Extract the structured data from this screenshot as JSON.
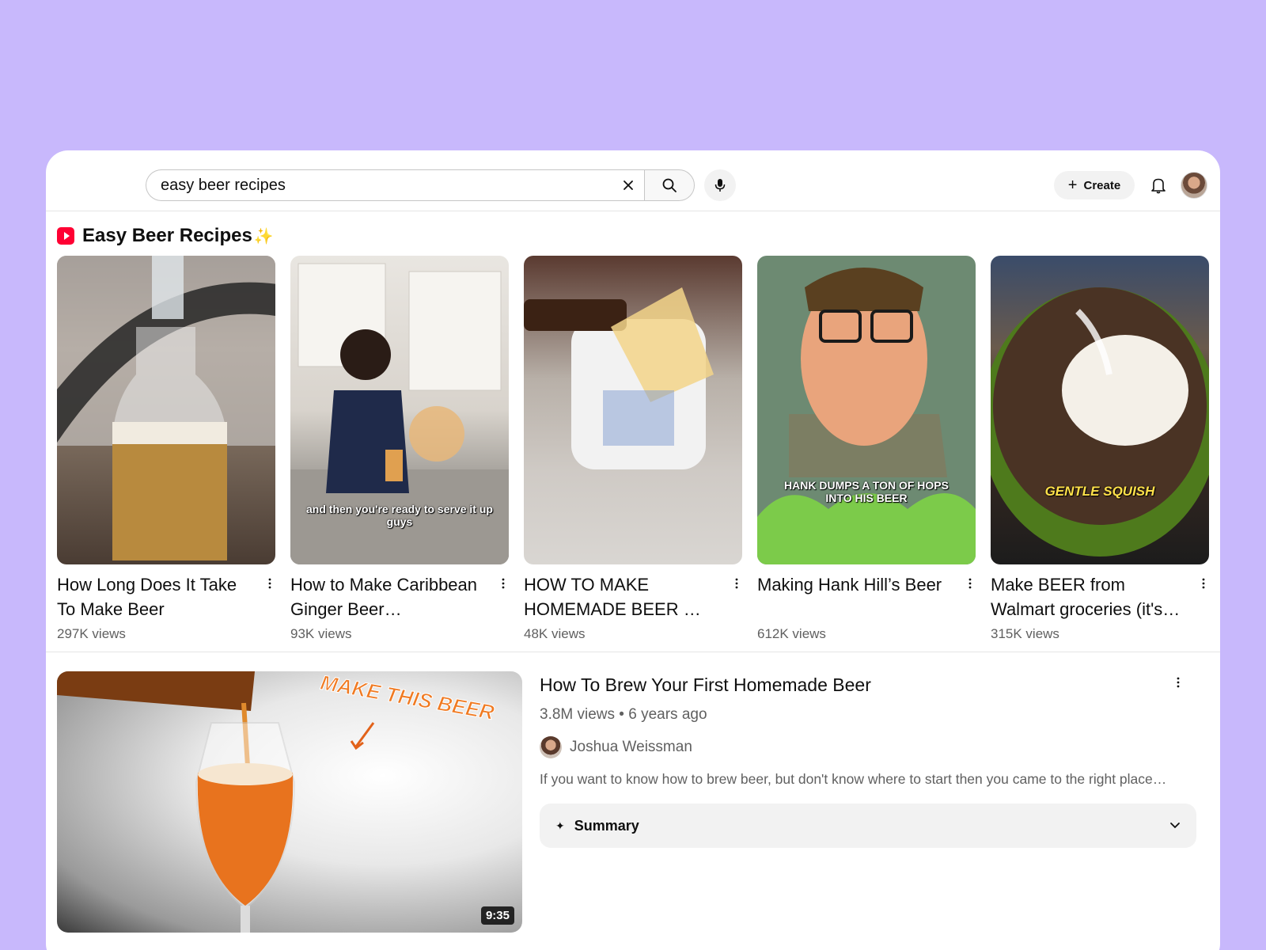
{
  "search": {
    "query": "easy beer recipes",
    "clear_icon": "close-icon",
    "search_icon": "search-icon",
    "mic_icon": "mic-icon"
  },
  "header": {
    "create_label": "Create",
    "bell_icon": "bell-icon"
  },
  "shelf": {
    "title": "Easy Beer Recipes",
    "sparkle": "✨",
    "shorts": [
      {
        "title": "How Long Does It Take To Make Beer",
        "views": "297K views",
        "overlay": ""
      },
      {
        "title": "How to Make Caribbean Ginger Beer (Authentic…",
        "views": "93K views",
        "overlay": "and then you're ready to serve it up guys"
      },
      {
        "title": "HOW TO MAKE HOMEMADE BEER 🤯 …",
        "views": "48K views",
        "overlay": ""
      },
      {
        "title": "Making Hank Hill’s Beer",
        "views": "612K views",
        "overlay": "HANK DUMPS A TON OF HOPS INTO HIS BEER"
      },
      {
        "title": "Make BEER from Walmart groceries (it's…",
        "views": "315K views",
        "overlay": "GENTLE SQUISH"
      }
    ]
  },
  "video": {
    "title": "How To Brew Your First Homemade Beer",
    "meta": "3.8M views • 6 years ago",
    "channel": "Joshua Weissman",
    "description": "If you want to know how to brew beer, but don't know where to start then you came to the right place…",
    "duration": "9:35",
    "thumb_text": "MAKE THIS BEER",
    "summary_label": "Summary"
  },
  "colors": {
    "background": "#c8b8fc",
    "youtube_red": "#ff0033",
    "secondary_text": "#606060"
  }
}
